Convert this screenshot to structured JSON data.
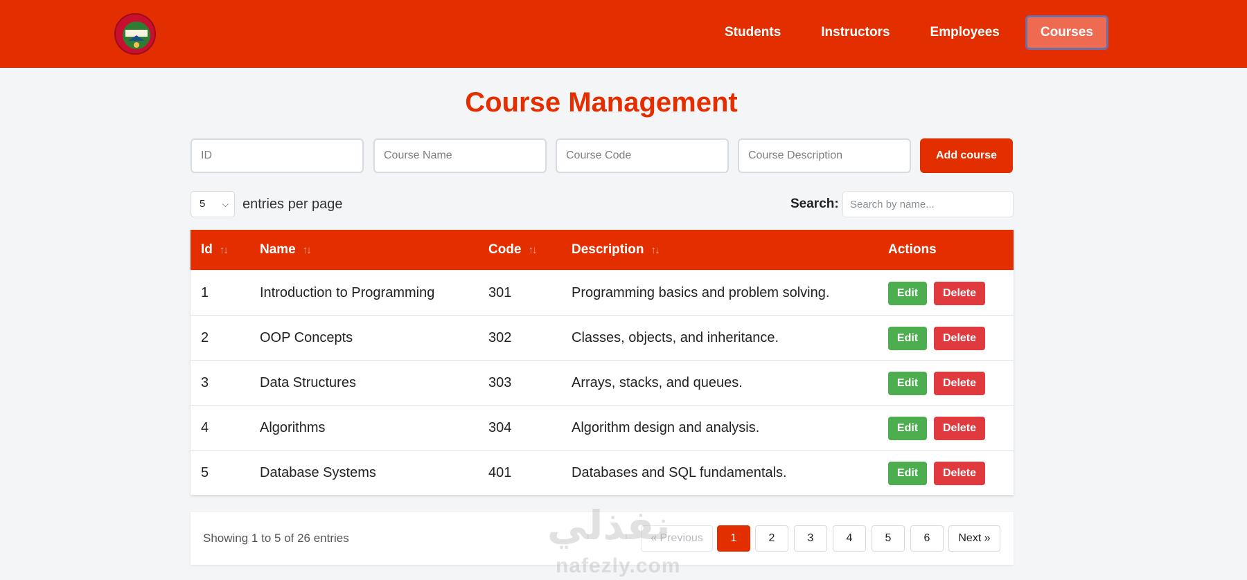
{
  "nav": {
    "links": [
      {
        "label": "Students"
      },
      {
        "label": "Instructors"
      },
      {
        "label": "Employees"
      },
      {
        "label": "Courses"
      }
    ]
  },
  "page_title": "Course Management",
  "form": {
    "id_placeholder": "ID",
    "name_placeholder": "Course Name",
    "code_placeholder": "Course Code",
    "description_placeholder": "Course Description",
    "add_label": "Add course"
  },
  "entries": {
    "value": "5",
    "label": "entries per page"
  },
  "search": {
    "label": "Search:",
    "placeholder": "Search by name..."
  },
  "table": {
    "headers": {
      "id": "Id",
      "name": "Name",
      "code": "Code",
      "description": "Description",
      "actions": "Actions"
    },
    "edit_label": "Edit",
    "delete_label": "Delete",
    "rows": [
      {
        "id": "1",
        "name": "Introduction to Programming",
        "code": "301",
        "description": "Programming basics and problem solving."
      },
      {
        "id": "2",
        "name": "OOP Concepts",
        "code": "302",
        "description": "Classes, objects, and inheritance."
      },
      {
        "id": "3",
        "name": "Data Structures",
        "code": "303",
        "description": "Arrays, stacks, and queues."
      },
      {
        "id": "4",
        "name": "Algorithms",
        "code": "304",
        "description": "Algorithm design and analysis."
      },
      {
        "id": "5",
        "name": "Database Systems",
        "code": "401",
        "description": "Databases and SQL fundamentals."
      }
    ]
  },
  "pagination": {
    "showing": "Showing 1 to 5 of 26 entries",
    "previous": "« Previous",
    "pages": [
      "1",
      "2",
      "3",
      "4",
      "5",
      "6"
    ],
    "next": "Next »",
    "current": "1"
  },
  "watermark": {
    "arabic": "نفذلي",
    "latin": "nafezly.com"
  },
  "colors": {
    "brand": "#e32e00",
    "edit": "#4cae4f",
    "delete": "#e03a3e"
  }
}
